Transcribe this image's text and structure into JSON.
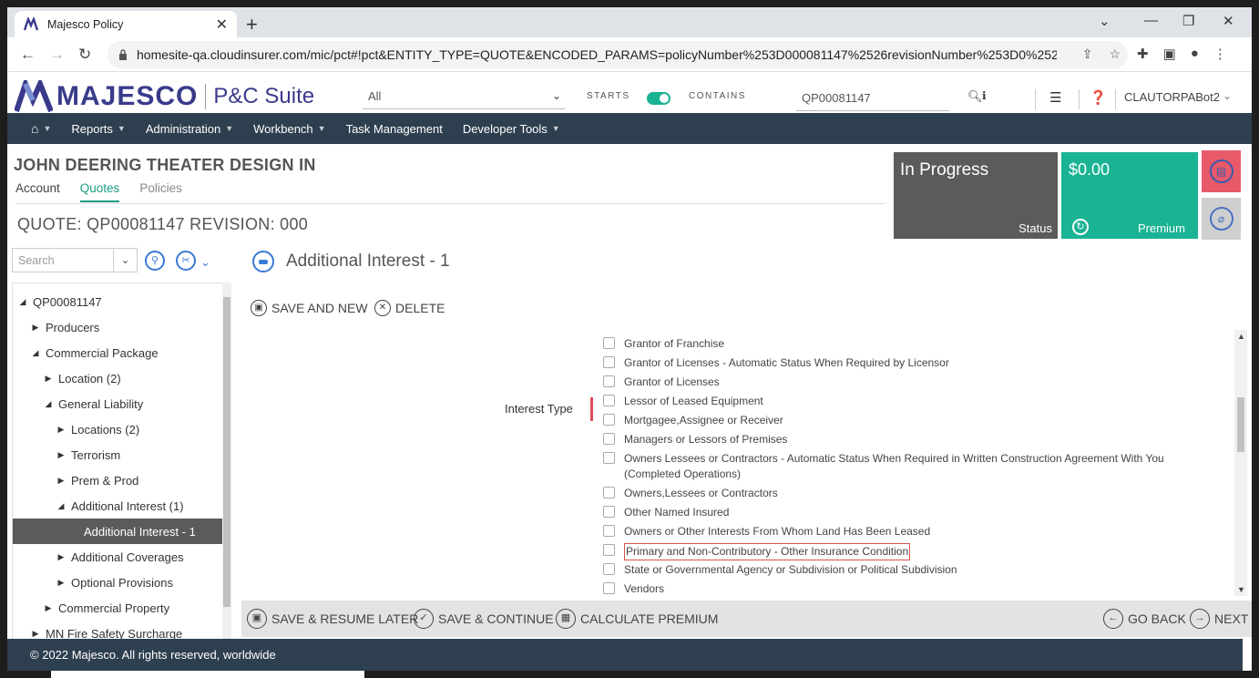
{
  "browser": {
    "tab_title": "Majesco Policy",
    "tab_close": "✕",
    "new_tab": "+",
    "url": "homesite-qa.cloudinsurer.com/mic/pct#!pct&ENTITY_TYPE=QUOTE&ENCODED_PARAMS=policyNumber%253D000081147%2526revisionNumber%253D0%2526p..."
  },
  "header": {
    "brand": "MAJESCO",
    "suite": "P&C Suite",
    "search_scope": "All",
    "starts_label": "STARTS",
    "contains_label": "CONTAINS",
    "quick_search_value": "QP00081147",
    "user": "CLAUTORPABot2"
  },
  "nav": {
    "items": [
      {
        "label": "Reports"
      },
      {
        "label": "Administration"
      },
      {
        "label": "Workbench"
      },
      {
        "label": "Task Management"
      },
      {
        "label": "Developer Tools"
      }
    ]
  },
  "account": {
    "name": "JOHN DEERING THEATER DESIGN IN",
    "tabs": [
      "Account",
      "Quotes",
      "Policies"
    ],
    "quote_title": "QUOTE:  QP00081147  REVISION:  000"
  },
  "status": {
    "value": "In Progress",
    "label": "Status",
    "accent": "#5b5b5b"
  },
  "premium": {
    "value": "$0.00",
    "label": "Premium",
    "accent": "#1ab394"
  },
  "tree": {
    "search_placeholder": "Search",
    "items": [
      {
        "label": "QP00081147"
      },
      {
        "label": "Producers"
      },
      {
        "label": "Commercial Package"
      },
      {
        "label": "Location (2)"
      },
      {
        "label": "General Liability"
      },
      {
        "label": "Locations (2)"
      },
      {
        "label": "Terrorism"
      },
      {
        "label": "Prem & Prod"
      },
      {
        "label": "Additional Interest (1)"
      },
      {
        "label": "Additional Interest - 1"
      },
      {
        "label": "Additional Coverages"
      },
      {
        "label": "Optional Provisions"
      },
      {
        "label": "Commercial Property"
      },
      {
        "label": "MN Fire Safety Surcharge"
      }
    ]
  },
  "main": {
    "title": "Additional Interest - 1",
    "save_and_new": "SAVE AND NEW",
    "delete": "DELETE",
    "interest_label": "Interest Type",
    "options": [
      {
        "label": "Grantor of Franchise"
      },
      {
        "label": "Grantor of Licenses - Automatic Status When Required by Licensor"
      },
      {
        "label": "Grantor of Licenses"
      },
      {
        "label": "Lessor of Leased Equipment"
      },
      {
        "label": "Mortgagee,Assignee or Receiver"
      },
      {
        "label": "Managers or Lessors of Premises"
      },
      {
        "label": "Owners Lessees or Contractors - Automatic Status When Required in Written Construction Agreement With You (Completed Operations)"
      },
      {
        "label": "Owners,Lessees or Contractors"
      },
      {
        "label": "Other Named Insured"
      },
      {
        "label": "Owners or Other Interests From Whom Land Has Been Leased"
      },
      {
        "label": "Primary and Non-Contributory - Other Insurance Condition"
      },
      {
        "label": "State or Governmental Agency or Subdivision or Political Subdivision"
      },
      {
        "label": "Vendors"
      }
    ]
  },
  "actions": {
    "save_resume": "SAVE & RESUME LATER",
    "save_continue": "SAVE & CONTINUE",
    "calculate": "CALCULATE PREMIUM",
    "go_back": "GO BACK",
    "next": "NEXT"
  },
  "footer": {
    "text": "©  2022 Majesco. All rights reserved, worldwide"
  }
}
